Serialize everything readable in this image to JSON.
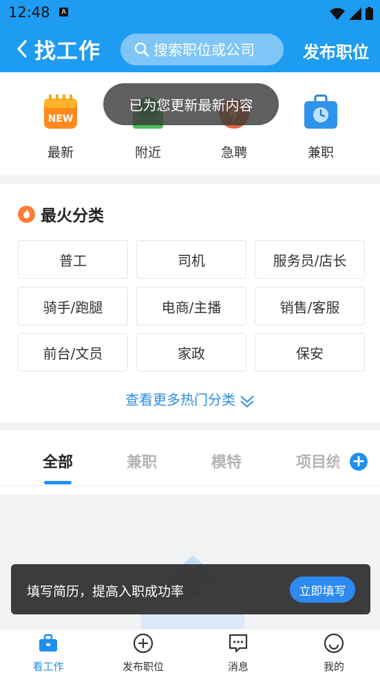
{
  "status_bar": {
    "time": "12:48",
    "badge": "A"
  },
  "header": {
    "title": "找工作",
    "search_placeholder": "搜索职位或公司",
    "publish_label": "发布职位"
  },
  "quick_entries": [
    {
      "label": "最新",
      "icon": "new-calendar-icon",
      "badge": "NEW"
    },
    {
      "label": "附近",
      "icon": "map-pin-icon"
    },
    {
      "label": "急聘",
      "icon": "urgent-icon"
    },
    {
      "label": "兼职",
      "icon": "briefcase-clock-icon"
    }
  ],
  "toast": "已为您更新最新内容",
  "hot": {
    "title": "最火分类",
    "categories": [
      "普工",
      "司机",
      "服务员/店长",
      "骑手/跑腿",
      "电商/主播",
      "销售/客服",
      "前台/文员",
      "家政",
      "保安"
    ],
    "more_label": "查看更多热门分类"
  },
  "tabs": {
    "items": [
      "全部",
      "兼职",
      "模特",
      "项目统"
    ],
    "active": "全部"
  },
  "banner": {
    "text": "填写简历，提高入职成功率",
    "button": "立即填写"
  },
  "bottom_nav": {
    "items": [
      {
        "label": "看工作",
        "icon": "briefcase-icon"
      },
      {
        "label": "发布职位",
        "icon": "plus-circle-icon"
      },
      {
        "label": "消息",
        "icon": "message-icon"
      },
      {
        "label": "我的",
        "icon": "profile-icon"
      }
    ],
    "active": "看工作"
  },
  "colors": {
    "primary": "#1e9cf2",
    "accent": "#1e8ef0",
    "link": "#2a8ee6"
  }
}
